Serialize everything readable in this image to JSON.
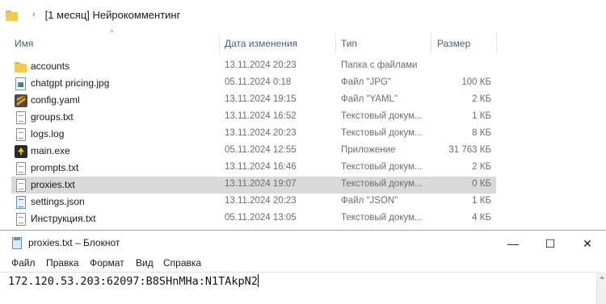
{
  "explorer": {
    "breadcrumb": "[1 месяц] Нейрокомментинг",
    "columns": {
      "name": "Имя",
      "date": "Дата изменения",
      "type": "Тип",
      "size": "Размер"
    },
    "files": [
      {
        "name": "accounts",
        "date": "13.11.2024 20:23",
        "type": "Папка с файлами",
        "size": "",
        "icon": "folder-icon"
      },
      {
        "name": "chatgpt pricing.jpg",
        "date": "05.11.2024 0:18",
        "type": "Файл \"JPG\"",
        "size": "100 КБ",
        "icon": "image-file-icon"
      },
      {
        "name": "config.yaml",
        "date": "13.11.2024 19:15",
        "type": "Файл \"YAML\"",
        "size": "2 КБ",
        "icon": "sublime-text-icon"
      },
      {
        "name": "groups.txt",
        "date": "13.11.2024 16:52",
        "type": "Текстовый докум...",
        "size": "1 КБ",
        "icon": "text-file-icon"
      },
      {
        "name": "logs.log",
        "date": "13.11.2024 20:23",
        "type": "Текстовый докум...",
        "size": "8 КБ",
        "icon": "text-file-icon"
      },
      {
        "name": "main.exe",
        "date": "05.11.2024 12:55",
        "type": "Приложение",
        "size": "31 763 КБ",
        "icon": "exe-app-icon"
      },
      {
        "name": "prompts.txt",
        "date": "13.11.2024 16:46",
        "type": "Текстовый докум...",
        "size": "2 КБ",
        "icon": "text-file-icon"
      },
      {
        "name": "proxies.txt",
        "date": "13.11.2024 19:07",
        "type": "Текстовый докум...",
        "size": "0 КБ",
        "icon": "text-file-icon",
        "selected": true
      },
      {
        "name": "settings.json",
        "date": "13.11.2024 20:23",
        "type": "Файл \"JSON\"",
        "size": "1 КБ",
        "icon": "json-file-icon"
      },
      {
        "name": "Инструкция.txt",
        "date": "05.11.2024 13:05",
        "type": "Текстовый докум...",
        "size": "4 КБ",
        "icon": "text-file-icon"
      }
    ]
  },
  "notepad": {
    "title": "proxies.txt – Блокнот",
    "menu": [
      "Файл",
      "Правка",
      "Формат",
      "Вид",
      "Справка"
    ],
    "content": "172.120.53.203:62097:B8SHnMHa:N1TAkpN2",
    "window_controls": {
      "minimize": "—",
      "maximize": "☐",
      "close": "✕"
    }
  }
}
